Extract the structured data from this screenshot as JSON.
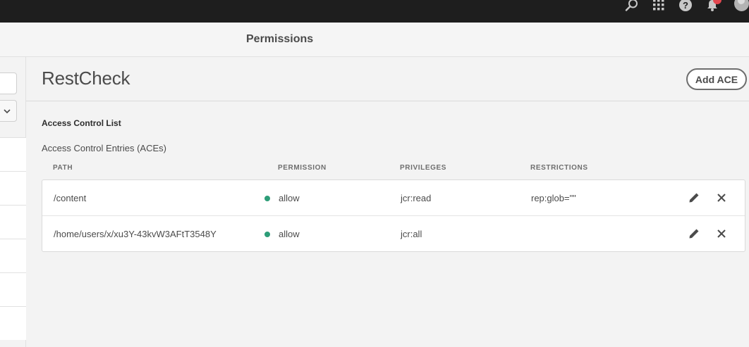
{
  "topbar": {
    "icons": [
      "search-icon",
      "apps-grid-icon",
      "help-icon",
      "bell-icon",
      "avatar"
    ],
    "help_glyph": "?"
  },
  "header": {
    "title": "Permissions"
  },
  "group": {
    "name": "RestCheck",
    "add_ace_label": "Add ACE"
  },
  "acl": {
    "title": "Access Control List",
    "aces_title": "Access Control Entries (ACEs)",
    "columns": {
      "path": "PATH",
      "permission": "PERMISSION",
      "privileges": "PRIVILEGES",
      "restrictions": "RESTRICTIONS"
    },
    "rows": [
      {
        "path": "/content",
        "permission": "allow",
        "privileges": "jcr:read",
        "restrictions": "rep:glob=\"\""
      },
      {
        "path": "/home/users/x/xu3Y-43kvW3AFtT3548Y",
        "permission": "allow",
        "privileges": "jcr:all",
        "restrictions": ""
      }
    ]
  },
  "colors": {
    "topbar": "#1e1e1e",
    "allow_dot": "#2d9d78",
    "notification_badge": "#e34850"
  }
}
